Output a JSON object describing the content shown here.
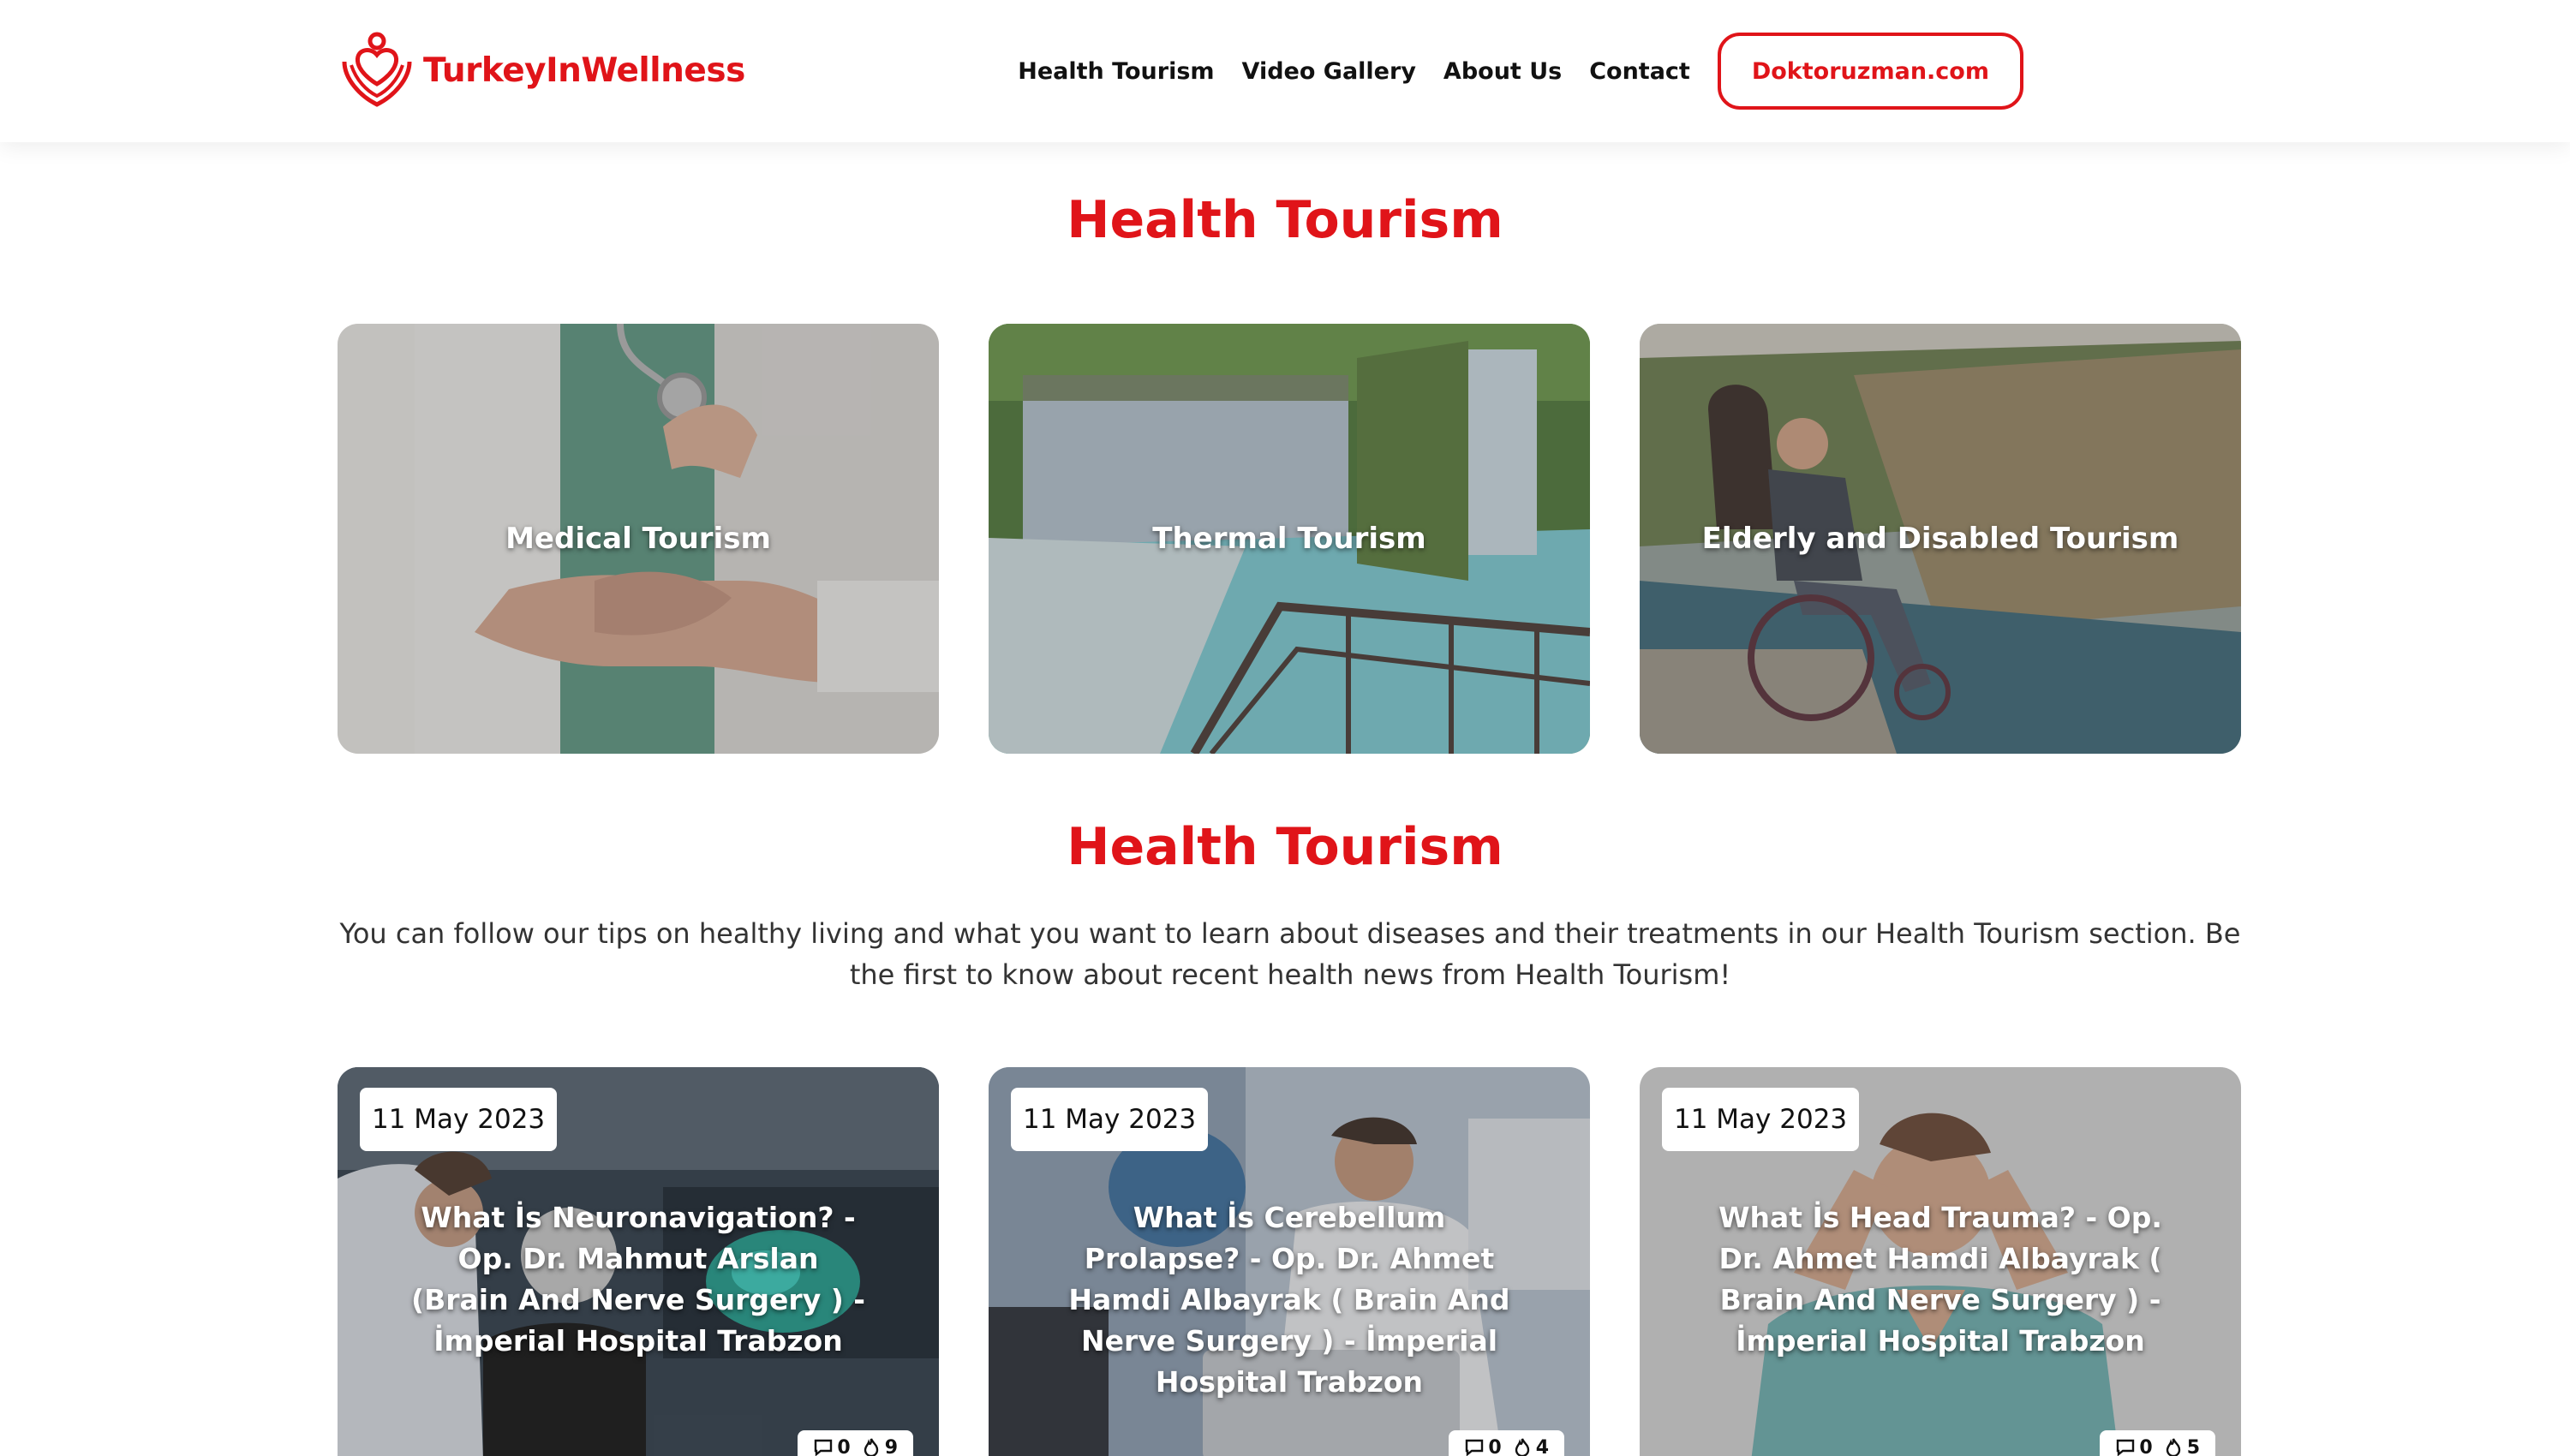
{
  "brand": {
    "name": "TurkeyInWellness",
    "accent": "#e01419"
  },
  "nav": {
    "items": [
      "Health Tourism",
      "Video Gallery",
      "About Us",
      "Contact"
    ],
    "cta": "Doktoruzman.com"
  },
  "categories_section": {
    "title": "Health Tourism",
    "cards": [
      {
        "label": "Medical Tourism"
      },
      {
        "label": "Thermal Tourism"
      },
      {
        "label": "Elderly and Disabled Tourism"
      }
    ]
  },
  "posts_section": {
    "title": "Health Tourism",
    "intro": "You can follow our tips on healthy living and what you want to learn about diseases and their treatments in our Health Tourism section. Be the first to know about recent health news from Health Tourism!",
    "posts": [
      {
        "date": "11 May 2023",
        "title": "What İs Neuronavigation? - Op. Dr. Mahmut Arslan (Brain And Nerve Surgery ) - İmperial Hospital Trabzon",
        "comments": "0",
        "views": "9"
      },
      {
        "date": "11 May 2023",
        "title": "What İs Cerebellum Prolapse? - Op. Dr. Ahmet Hamdi Albayrak ( Brain And Nerve Surgery ) - İmperial Hospital Trabzon",
        "comments": "0",
        "views": "4"
      },
      {
        "date": "11 May 2023",
        "title": "What İs Head Trauma? - Op. Dr. Ahmet Hamdi Albayrak ( Brain And Nerve Surgery ) - İmperial Hospital Trabzon",
        "comments": "0",
        "views": "5"
      }
    ]
  },
  "icons": {
    "comment": "comment-icon",
    "view": "flame-icon",
    "logo": "heart-hands-logo"
  }
}
